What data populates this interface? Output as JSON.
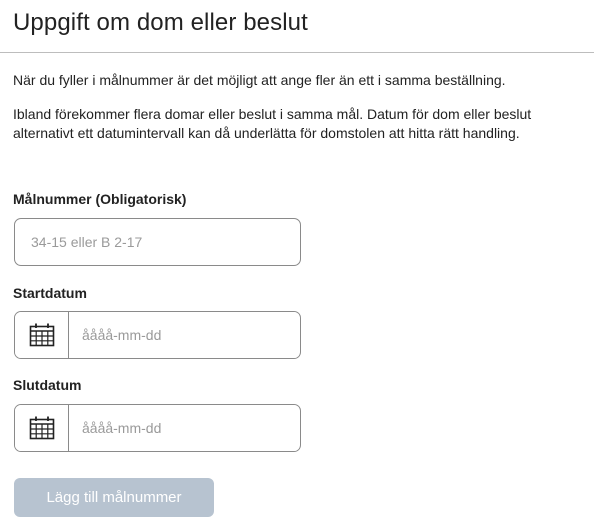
{
  "section": {
    "title": "Uppgift om dom eller beslut",
    "intro_1": "När du fyller i målnummer är det möjligt att ange fler än ett i samma beställning.",
    "intro_2": "Ibland förekommer flera domar eller beslut i samma mål. Datum för dom eller beslut alternativt ett datumintervall kan då underlätta för domstolen att hitta rätt handling."
  },
  "case_number": {
    "label": "Målnummer (Obligatorisk)",
    "value": "",
    "placeholder": "34-15 eller B 2-17"
  },
  "start_date": {
    "label": "Startdatum",
    "value": "",
    "placeholder": "åååå-mm-dd",
    "icon": "calendar-icon"
  },
  "end_date": {
    "label": "Slutdatum",
    "value": "",
    "placeholder": "åååå-mm-dd",
    "icon": "calendar-icon"
  },
  "actions": {
    "add_label": "Lägg till målnummer",
    "add_disabled": true
  },
  "colors": {
    "text": "#222222",
    "border": "#8a8a8a",
    "placeholder": "#9a9a9a",
    "button_disabled_bg": "#b7c3d0",
    "button_text": "#ffffff"
  }
}
